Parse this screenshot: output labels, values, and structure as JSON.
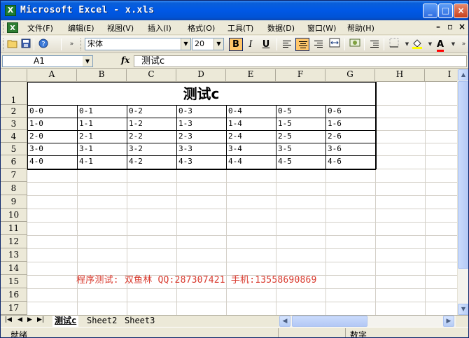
{
  "window": {
    "title": "Microsoft Excel - x.xls",
    "app_icon": "excel-icon",
    "controls": [
      "_",
      "□",
      "×"
    ]
  },
  "menubar": {
    "items": [
      {
        "label": "文件(F)"
      },
      {
        "label": "编辑(E)"
      },
      {
        "label": "视图(V)"
      },
      {
        "label": "插入(I)"
      },
      {
        "label": "格式(O)"
      },
      {
        "label": "工具(T)"
      },
      {
        "label": "数据(D)"
      },
      {
        "label": "窗口(W)"
      },
      {
        "label": "帮助(H)"
      }
    ],
    "doc_controls": [
      "–",
      "▫",
      "×"
    ]
  },
  "toolbar": {
    "font_name": "宋体",
    "font_size": "20",
    "bold": "B",
    "italic": "I",
    "underline": "U",
    "center_selected": true,
    "fill_color": "#FFFF00",
    "font_color": "#FF0000"
  },
  "formula_bar": {
    "name_box": "A1",
    "fx": "fx",
    "content": "测试c"
  },
  "sheet": {
    "columns": [
      "A",
      "B",
      "C",
      "D",
      "E",
      "F",
      "G",
      "H",
      "I"
    ],
    "rows": [
      "1",
      "2",
      "3",
      "4",
      "5",
      "6",
      "7",
      "8",
      "9",
      "10",
      "11",
      "12",
      "13",
      "14",
      "15",
      "16",
      "17"
    ],
    "title_cell": "测试c",
    "data": [
      [
        "0-0",
        "0-1",
        "0-2",
        "0-3",
        "0-4",
        "0-5",
        "0-6"
      ],
      [
        "1-0",
        "1-1",
        "1-2",
        "1-3",
        "1-4",
        "1-5",
        "1-6"
      ],
      [
        "2-0",
        "2-1",
        "2-2",
        "2-3",
        "2-4",
        "2-5",
        "2-6"
      ],
      [
        "3-0",
        "3-1",
        "3-2",
        "3-3",
        "3-4",
        "3-5",
        "3-6"
      ],
      [
        "4-0",
        "4-1",
        "4-2",
        "4-3",
        "4-4",
        "4-5",
        "4-6"
      ]
    ],
    "overlay_text": "程序测试: 双鱼林 QQ:287307421 手机:13558690869"
  },
  "tabs": {
    "nav": [
      "|◀",
      "◀",
      "▶",
      "▶|"
    ],
    "sheets": [
      "测试c",
      "Sheet2",
      "Sheet3"
    ],
    "active": 0
  },
  "statusbar": {
    "status": "就绪",
    "mode": "数字"
  },
  "colors": {
    "title_bar": "#0058E6",
    "overlay_text": "#D93A2E",
    "grid_line": "#D4D0C8"
  }
}
